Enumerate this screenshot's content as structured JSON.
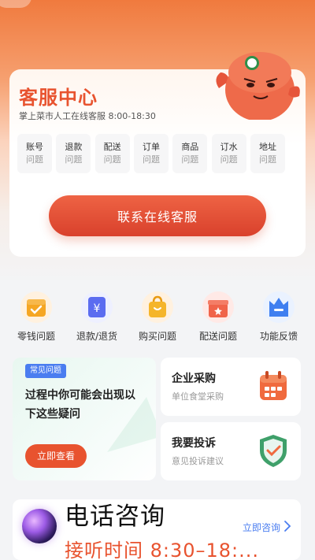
{
  "service": {
    "title": "客服中心",
    "subtitle": "掌上菜市人工在线客服  8:00-18:30",
    "categories": [
      {
        "name": "账号",
        "sub": "问题"
      },
      {
        "name": "退款",
        "sub": "问题"
      },
      {
        "name": "配送",
        "sub": "问题"
      },
      {
        "name": "订单",
        "sub": "问题"
      },
      {
        "name": "商品",
        "sub": "问题"
      },
      {
        "name": "订水",
        "sub": "问题"
      },
      {
        "name": "地址",
        "sub": "问题"
      }
    ],
    "contact_button": "联系在线客服"
  },
  "quick": [
    {
      "label": "零钱问题",
      "icon": "wallet-icon"
    },
    {
      "label": "退款/退货",
      "icon": "refund-yen-icon"
    },
    {
      "label": "购买问题",
      "icon": "shopping-bag-icon"
    },
    {
      "label": "配送问题",
      "icon": "gift-box-icon"
    },
    {
      "label": "功能反馈",
      "icon": "crown-feedback-icon"
    }
  ],
  "faq": {
    "badge": "常见问题",
    "text": "过程中你可能会出现以下这些疑问",
    "button": "立即查看"
  },
  "procurement": {
    "title": "企业采购",
    "sub": "单位食堂采购",
    "icon": "calendar-icon"
  },
  "complaint": {
    "title": "我要投诉",
    "sub": "意见投诉建议",
    "icon": "shield-check-icon"
  },
  "phone": {
    "title": "电话咨询",
    "time": "接听时间 8:30–18:...",
    "link": "立即咨询"
  },
  "colors": {
    "accent": "#e8532f",
    "link": "#4a7df0"
  }
}
